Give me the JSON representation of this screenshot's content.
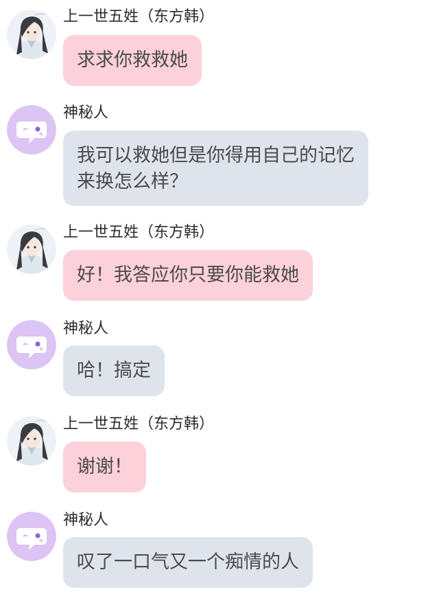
{
  "colors": {
    "pink_bubble": "#fcd1da",
    "gray_bubble": "#dfe4ec",
    "mystery_avatar": "#dcc4f4"
  },
  "messages": [
    {
      "sender": "上一世五姓（东方韩）",
      "avatar": "anime-character-avatar",
      "style": "pink",
      "lines": [
        "求求你救救她"
      ]
    },
    {
      "sender": "神秘人",
      "avatar": "mystery-chat-avatar",
      "style": "gray",
      "lines": [
        "我可以救她但是你得用自己的记忆",
        "来换怎么样？"
      ]
    },
    {
      "sender": "上一世五姓（东方韩）",
      "avatar": "anime-character-avatar",
      "style": "pink",
      "lines": [
        "好！我答应你只要你能救她"
      ]
    },
    {
      "sender": "神秘人",
      "avatar": "mystery-chat-avatar",
      "style": "gray",
      "lines": [
        "哈！搞定"
      ]
    },
    {
      "sender": "上一世五姓（东方韩）",
      "avatar": "anime-character-avatar",
      "style": "pink",
      "lines": [
        "谢谢！"
      ]
    },
    {
      "sender": "神秘人",
      "avatar": "mystery-chat-avatar",
      "style": "gray",
      "lines": [
        "叹了一口气又一个痴情的人"
      ]
    }
  ]
}
